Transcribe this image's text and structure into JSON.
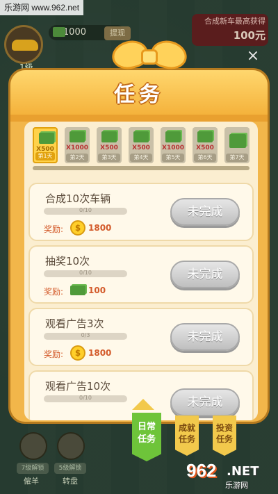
{
  "watermark": "乐游网 www.962.net",
  "hud": {
    "money": "1000",
    "level": "1级",
    "mid_button": "提现",
    "promo_text": "合成新车最高获得",
    "promo_price": "100元"
  },
  "panel": {
    "title": "任务",
    "close_label": "×"
  },
  "days": [
    {
      "amount": "X500",
      "label": "第1天",
      "active": true
    },
    {
      "amount": "X1000",
      "label": "第2天",
      "active": false
    },
    {
      "amount": "X500",
      "label": "第3天",
      "active": false
    },
    {
      "amount": "X500",
      "label": "第4天",
      "active": false
    },
    {
      "amount": "X1000",
      "label": "第5天",
      "active": false
    },
    {
      "amount": "X500",
      "label": "第6天",
      "active": false
    },
    {
      "amount": "",
      "label": "第7天",
      "active": false
    }
  ],
  "tasks": [
    {
      "name": "合成10次车辆",
      "progress": "0/10",
      "reward_label": "奖励:",
      "reward_type": "coin-icon",
      "reward_amount": "1800",
      "button": "未完成"
    },
    {
      "name": "抽奖10次",
      "progress": "0/10",
      "reward_label": "奖励:",
      "reward_type": "cash-icon",
      "reward_amount": "100",
      "button": "未完成"
    },
    {
      "name": "观看广告3次",
      "progress": "0/3",
      "reward_label": "奖励:",
      "reward_type": "coin-icon",
      "reward_amount": "1800",
      "button": "未完成"
    },
    {
      "name": "观看广告10次",
      "progress": "0/10",
      "reward_label": "",
      "reward_type": "",
      "reward_amount": "",
      "button": "未完成"
    }
  ],
  "tabs": [
    {
      "line1": "日常",
      "line2": "任务",
      "active": true
    },
    {
      "line1": "成就",
      "line2": "任务",
      "active": false
    },
    {
      "line1": "投资",
      "line2": "任务",
      "active": false
    }
  ],
  "bottom": {
    "chip1": "7级解锁",
    "chip2": "5级解锁",
    "label1": "僱羊",
    "label2": "转盘"
  },
  "logo": {
    "num": "962",
    "net": ".NET",
    "sub": "乐游网"
  },
  "colors": {
    "panel": "#f2b64a",
    "active_tab": "#6ec43a",
    "reward_text": "#d35a2a"
  }
}
